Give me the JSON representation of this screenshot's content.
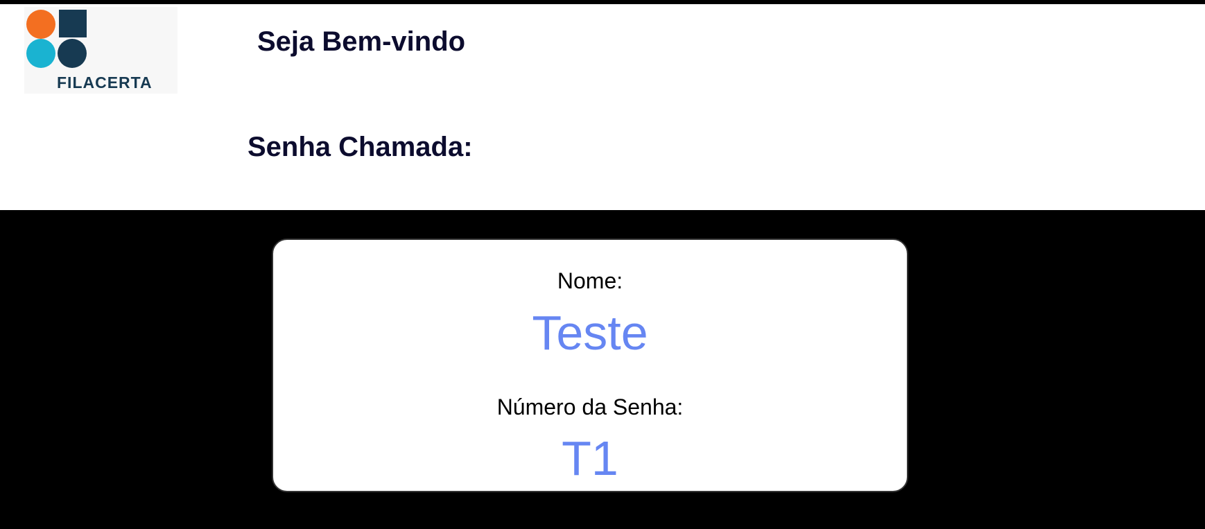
{
  "brand": {
    "name": "FILACERTA",
    "colors": {
      "orange": "#f36f21",
      "cyan": "#1ab3d1",
      "navy": "#173a52"
    }
  },
  "header": {
    "welcome": "Seja Bem-vindo",
    "called_title": "Senha Chamada:"
  },
  "card": {
    "name_label": "Nome:",
    "name_value": "Teste",
    "number_label": "Número da Senha:",
    "number_value": "T1",
    "value_color": "#6686f2"
  }
}
